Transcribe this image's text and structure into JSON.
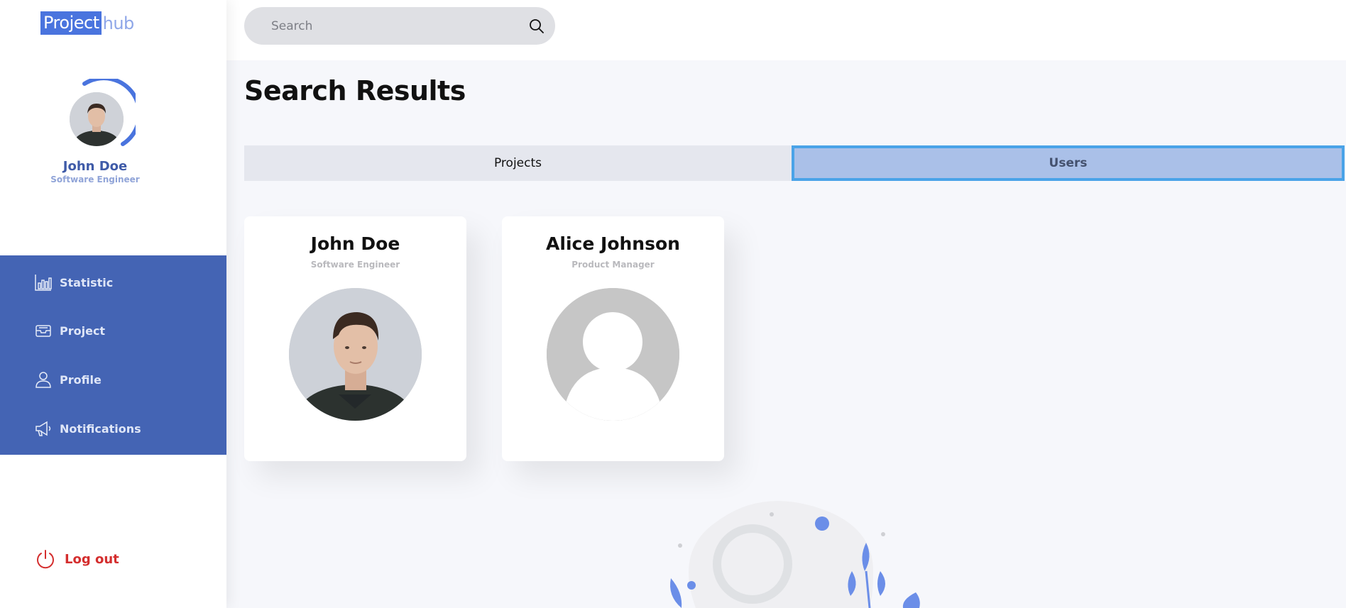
{
  "brand": {
    "part1": "Project",
    "part2": "hub"
  },
  "user": {
    "name": "John Doe",
    "role": "Software Engineer"
  },
  "nav": {
    "items": [
      {
        "label": "Statistic",
        "icon": "bar-chart-icon"
      },
      {
        "label": "Project",
        "icon": "inbox-icon"
      },
      {
        "label": "Profile",
        "icon": "user-icon"
      },
      {
        "label": "Notifications",
        "icon": "megaphone-icon"
      }
    ],
    "logout": "Log out"
  },
  "search": {
    "placeholder": "Search",
    "value": ""
  },
  "page": {
    "title": "Search Results"
  },
  "tabs": [
    {
      "label": "Projects",
      "active": false
    },
    {
      "label": "Users",
      "active": true
    }
  ],
  "results": [
    {
      "name": "John Doe",
      "role": "Software Engineer",
      "avatar": "photo"
    },
    {
      "name": "Alice Johnson",
      "role": "Product Manager",
      "avatar": "placeholder"
    }
  ],
  "colors": {
    "sidebar_nav": "#4464b4",
    "accent": "#4a74de",
    "active_tab": "#aac0e8",
    "active_tab_border": "#4aa3e8",
    "logout": "#d42e2e"
  }
}
